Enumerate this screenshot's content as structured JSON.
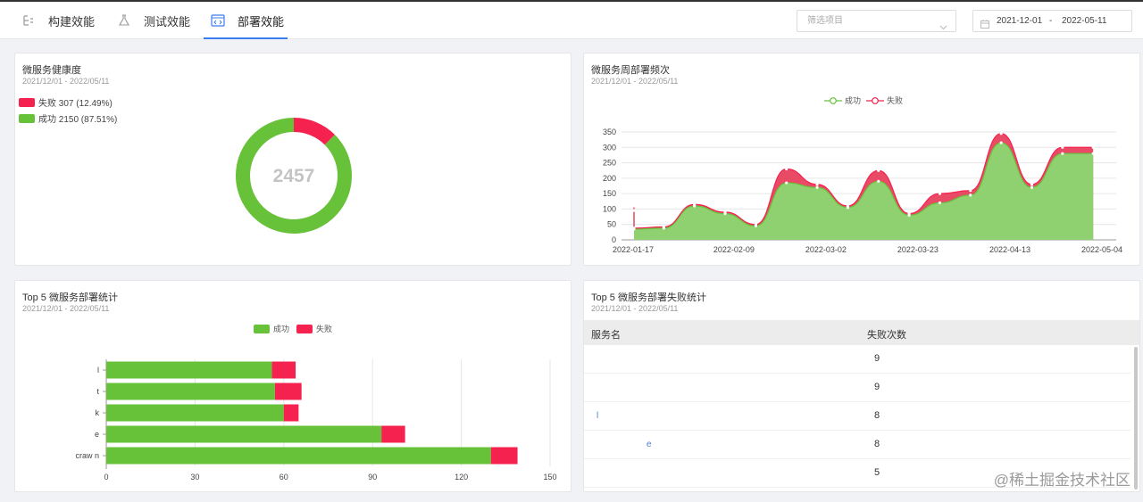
{
  "tabs": [
    {
      "label": "构建效能",
      "icon": "build-icon"
    },
    {
      "label": "测试效能",
      "icon": "flask-icon"
    },
    {
      "label": "部署效能",
      "icon": "code-icon"
    }
  ],
  "filter": {
    "placeholder": "筛选项目"
  },
  "date_range": {
    "start": "2021-12-01",
    "separator": "-",
    "end": "2022-05-11"
  },
  "health": {
    "title": "微服务健康度",
    "subtitle": "2021/12/01 - 2022/05/11",
    "legend": [
      {
        "label": "失败 307 (12.49%)",
        "color": "#f5224f"
      },
      {
        "label": "成功 2150 (87.51%)",
        "color": "#67c23a"
      }
    ],
    "total": "2457"
  },
  "weekly": {
    "title": "微服务周部署频次",
    "subtitle": "2021/12/01 - 2022/05/11",
    "legend": [
      {
        "label": "成功",
        "color": "#67c23a"
      },
      {
        "label": "失败",
        "color": "#f5224f"
      }
    ]
  },
  "top5": {
    "title": "Top 5 微服务部署统计",
    "subtitle": "2021/12/01 - 2022/05/11",
    "legend": [
      {
        "label": "成功",
        "color": "#67c23a"
      },
      {
        "label": "失败",
        "color": "#f5224f"
      }
    ],
    "row_labels": [
      "l",
      "t",
      "k",
      "e",
      "craw        n"
    ]
  },
  "fail_table": {
    "title": "Top 5 微服务部署失败统计",
    "subtitle": "2021/12/01 - 2022/05/11",
    "columns": [
      "服务名",
      "失败次数"
    ],
    "rows": [
      {
        "name": "",
        "count": "9"
      },
      {
        "name": "",
        "count": "9"
      },
      {
        "name": "l",
        "count": "8"
      },
      {
        "name": "e",
        "count": "8"
      },
      {
        "name": "",
        "count": "5"
      }
    ]
  },
  "watermark": "@稀土掘金技术社区",
  "chart_data": [
    {
      "type": "pie",
      "categories": [
        "失败",
        "成功"
      ],
      "values": [
        307,
        2150
      ],
      "colors": [
        "#f5224f",
        "#67c23a"
      ],
      "center_label": "2457"
    },
    {
      "type": "area",
      "x": [
        "2022-01-10",
        "2022-01-17",
        "2022-01-24",
        "2022-01-31",
        "2022-02-07",
        "2022-02-14",
        "2022-02-21",
        "2022-02-28",
        "2022-03-07",
        "2022-03-14",
        "2022-03-21",
        "2022-03-28",
        "2022-04-04",
        "2022-04-11",
        "2022-04-18",
        "2022-04-25",
        "2022-05-02"
      ],
      "x_ticks": [
        "2022-01-17",
        "2022-02-09",
        "2022-03-02",
        "2022-03-23",
        "2022-04-13",
        "2022-05-04"
      ],
      "y_ticks": [
        0,
        50,
        100,
        150,
        200,
        250,
        300,
        350
      ],
      "ylim": [
        0,
        350
      ],
      "grid": true,
      "legend": "top-center",
      "series": [
        {
          "name": "成功",
          "color": "#67c23a",
          "values": [
            95,
            35,
            38,
            110,
            85,
            45,
            185,
            170,
            105,
            190,
            80,
            120,
            145,
            315,
            170,
            280,
            280
          ]
        },
        {
          "name": "失败",
          "color": "#f5224f",
          "values": [
            15,
            3,
            4,
            5,
            5,
            5,
            45,
            10,
            5,
            35,
            5,
            30,
            15,
            30,
            10,
            20,
            20
          ]
        }
      ]
    },
    {
      "type": "bar",
      "orientation": "horizontal",
      "stacked": true,
      "categories": [
        "l",
        "t",
        "k",
        "e",
        "craw        n"
      ],
      "x_ticks": [
        0,
        30,
        60,
        90,
        120,
        150
      ],
      "xlim": [
        0,
        150
      ],
      "legend": "top-center",
      "series": [
        {
          "name": "成功",
          "color": "#67c23a",
          "values": [
            56,
            57,
            60,
            93,
            130
          ]
        },
        {
          "name": "失败",
          "color": "#f5224f",
          "values": [
            8,
            9,
            5,
            8,
            9
          ]
        }
      ]
    }
  ]
}
